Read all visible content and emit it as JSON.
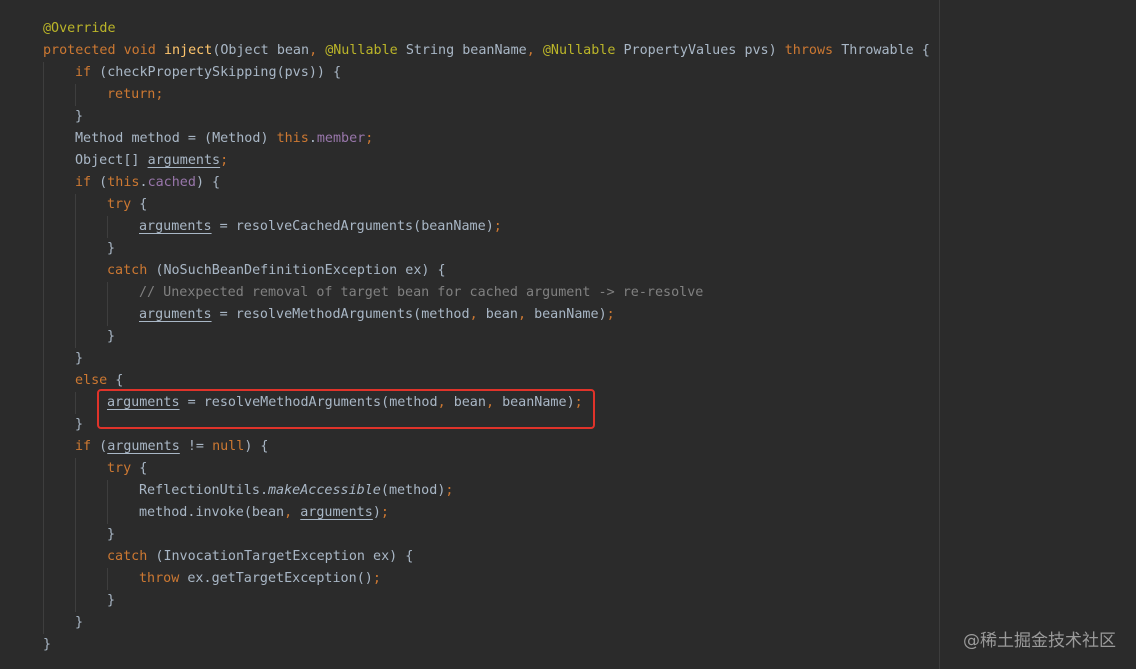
{
  "code": {
    "annotation_override": "@Override",
    "kw_protected": "protected",
    "kw_void": "void",
    "method_name": "inject",
    "param_type_object": "Object",
    "param_bean": "bean",
    "ann_nullable": "@Nullable",
    "type_string": "String",
    "param_beanname": "beanName",
    "type_propertyvalues": "PropertyValues",
    "param_pvs": "pvs",
    "kw_throws": "throws",
    "type_throwable": "Throwable",
    "kw_if": "if",
    "call_check_skipping": "checkPropertySkipping",
    "kw_return": "return",
    "type_method": "Method",
    "var_method": "method",
    "kw_this": "this",
    "field_member": "member",
    "type_object_array": "Object[]",
    "var_arguments": "arguments",
    "field_cached": "cached",
    "kw_try": "try",
    "call_resolve_cached": "resolveCachedArguments",
    "kw_catch": "catch",
    "exc_nosuchbean": "NoSuchBeanDefinitionException",
    "var_ex": "ex",
    "comment_reresolve": "// Unexpected removal of target bean for cached argument -> re-resolve",
    "call_resolve_method": "resolveMethodArguments",
    "kw_else": "else",
    "kw_null": "null",
    "type_reflectionutils": "ReflectionUtils",
    "call_make_accessible": "makeAccessible",
    "call_invoke": "invoke",
    "exc_invocationtarget": "InvocationTargetException",
    "kw_throw": "throw",
    "call_get_target": "getTargetException"
  },
  "watermark": "@稀土掘金技术社区",
  "colors": {
    "background": "#2b2b2b",
    "text": "#a9b7c6",
    "keyword": "#cc7832",
    "annotation": "#bbb529",
    "method_declaration": "#ffc66d",
    "field": "#9876aa",
    "comment": "#808080",
    "highlight_box": "#e0332a"
  }
}
